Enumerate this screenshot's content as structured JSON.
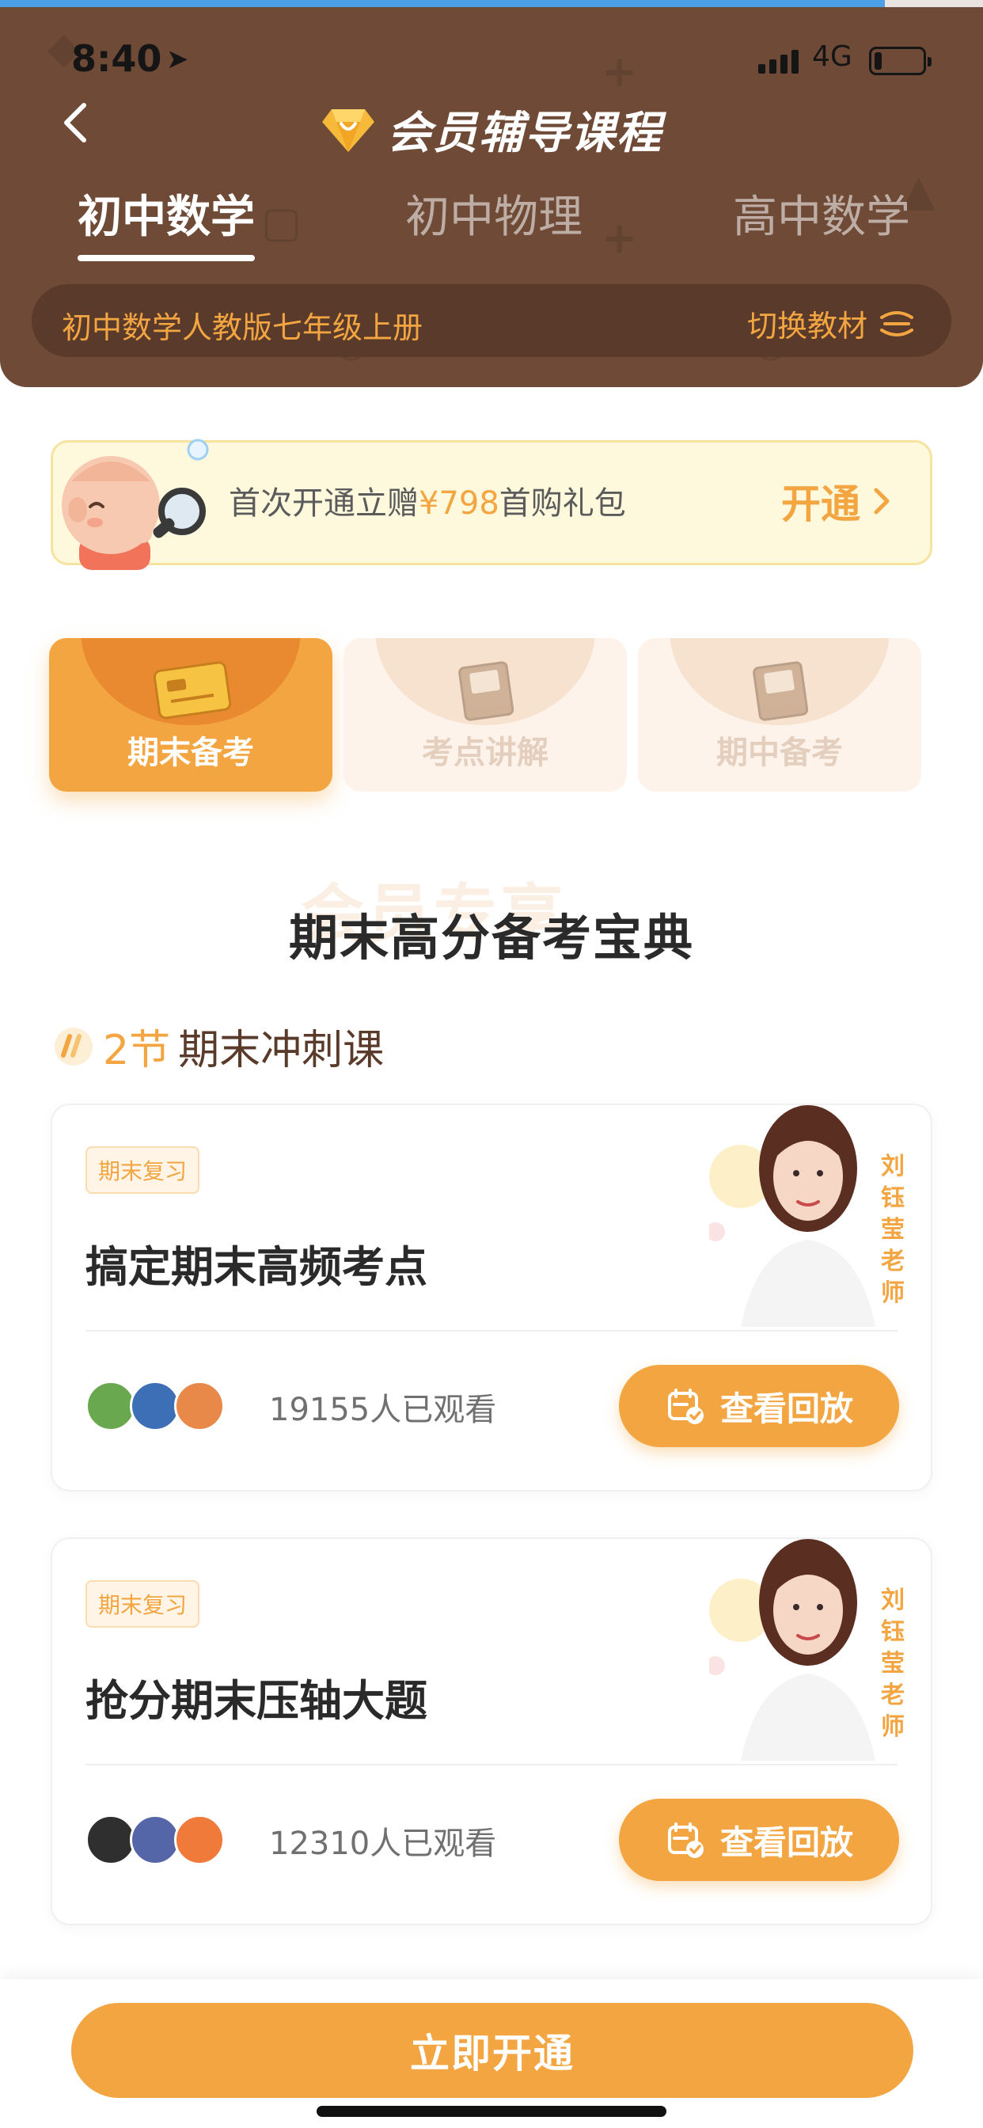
{
  "status_bar": {
    "time": "8:40",
    "network": "4G",
    "battery_level": 0.15
  },
  "page_progress": 0.9,
  "header": {
    "title": "会员辅导课程",
    "tabs": [
      {
        "label": "初中数学",
        "active": true
      },
      {
        "label": "初中物理",
        "active": false
      },
      {
        "label": "高中数学",
        "active": false
      }
    ],
    "textbook": {
      "label": "初中数学人教版七年级上册",
      "switch_label": "切换教材"
    }
  },
  "promo": {
    "text_before": "首次开通立赠",
    "amount": "¥798",
    "text_after": "首购礼包",
    "open_label": "开通"
  },
  "categories": [
    {
      "label": "期末备考",
      "active": true
    },
    {
      "label": "考点讲解",
      "active": false
    },
    {
      "label": "期中备考",
      "active": false
    }
  ],
  "section": {
    "watermark": "会员专享",
    "title": "期末高分备考宝典",
    "count_num": "2节",
    "count_text": "期末冲刺课"
  },
  "courses": [
    {
      "tag": "期末复习",
      "title": "搞定期末高频考点",
      "views": "19155人已观看",
      "replay_label": "查看回放",
      "teacher": "刘钰莹老师"
    },
    {
      "tag": "期末复习",
      "title": "抢分期末压轴大题",
      "views": "12310人已观看",
      "replay_label": "查看回放",
      "teacher": "刘钰莹老师"
    }
  ],
  "bottom": {
    "cta_label": "立即开通"
  },
  "colors": {
    "brand_brown": "#6e4a37",
    "accent_orange": "#f2a540",
    "promo_bg": "#fef9dd"
  }
}
